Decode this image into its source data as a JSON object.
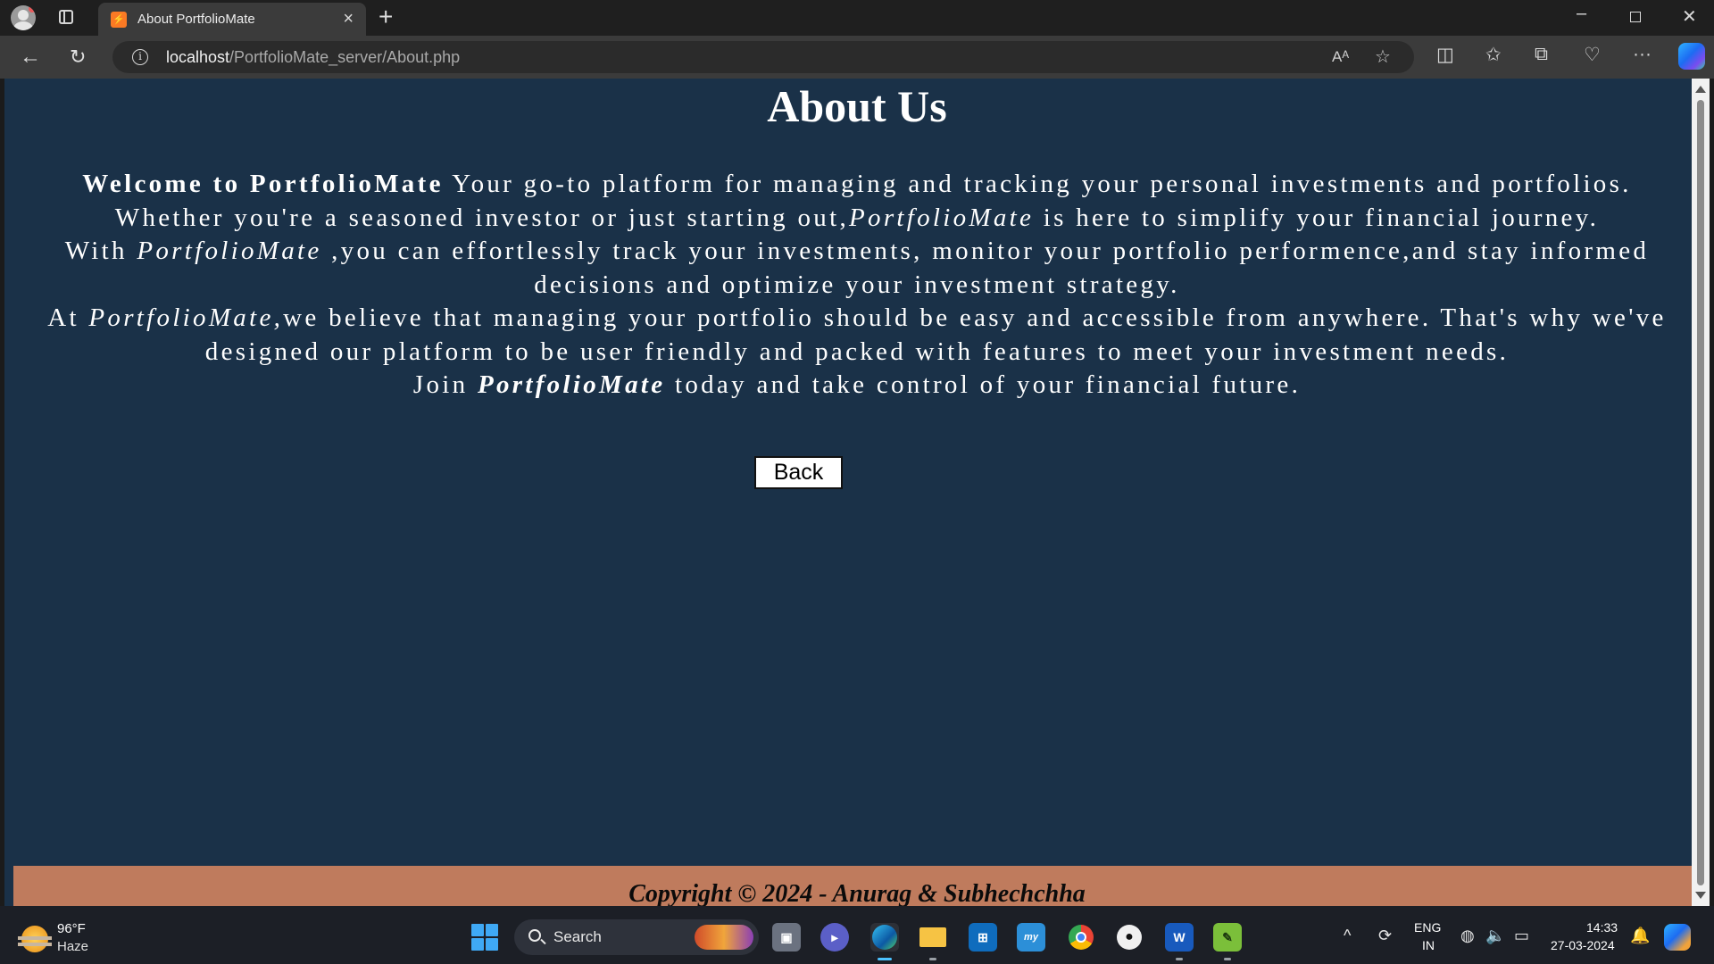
{
  "browser": {
    "tab_title": "About PortfolioMate",
    "tab_favicon": "xampp-icon",
    "url_host": "localhost",
    "url_path": "/PortfolioMate_server/About.php",
    "read_aloud_label": "Aᴬ"
  },
  "page": {
    "title": "About Us",
    "p1_bold": "Welcome to PortfolioMate",
    "p1_a": " Your go-to platform for managing and tracking your personal investments and portfolios. Whether you're a seasoned investor or just starting out,",
    "p1_italic": "PortfolioMate",
    "p1_b": " is here to simplify your financial journey.",
    "p2_a": "With ",
    "p2_italic": "PortfolioMate",
    "p2_b": " ,you can effortlessly track your investments, monitor your portfolio performence,and stay informed decisions and optimize your investment strategy.",
    "p3_a": "At ",
    "p3_italic": "PortfolioMate,",
    "p3_b": "we believe that managing your portfolio should be easy and accessible from anywhere. That's why we've designed our platform to be user friendly and packed with features to meet your investment needs.",
    "p4_a": "Join ",
    "p4_bold_italic": "PortfolioMate",
    "p4_b": " today and take control of your financial future.",
    "back_label": "Back",
    "footer": "Copyright © 2024 - Anurag & Subhechchha",
    "colors": {
      "background": "#1a3148",
      "footer": "#bf7b5d"
    }
  },
  "taskbar": {
    "weather_temp": "96°F",
    "weather_condition": "Haze",
    "search_label": "Search",
    "language": "ENG",
    "region": "IN",
    "time": "14:33",
    "date": "27-03-2024",
    "apps": [
      "task-view",
      "teams",
      "edge",
      "file-explorer",
      "microsoft-store",
      "mylip",
      "chrome",
      "github",
      "word",
      "notepad-plus-plus"
    ]
  }
}
